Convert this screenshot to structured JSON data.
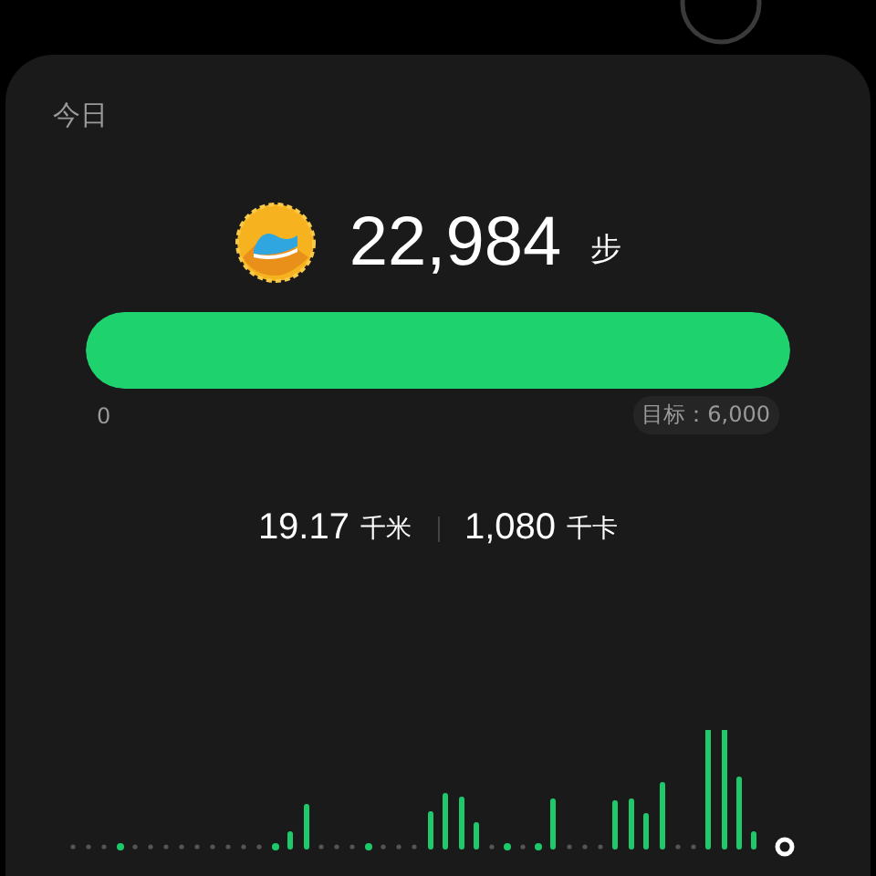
{
  "card": {
    "title": "今日"
  },
  "steps": {
    "value": "22,984",
    "unit": "步"
  },
  "progress": {
    "level": 1,
    "start": "0",
    "goal": "目标：6,000"
  },
  "stats": [
    {
      "value": "19.17",
      "unit": "千米"
    },
    {
      "value": "1,080",
      "unit": "千卡"
    }
  ]
}
